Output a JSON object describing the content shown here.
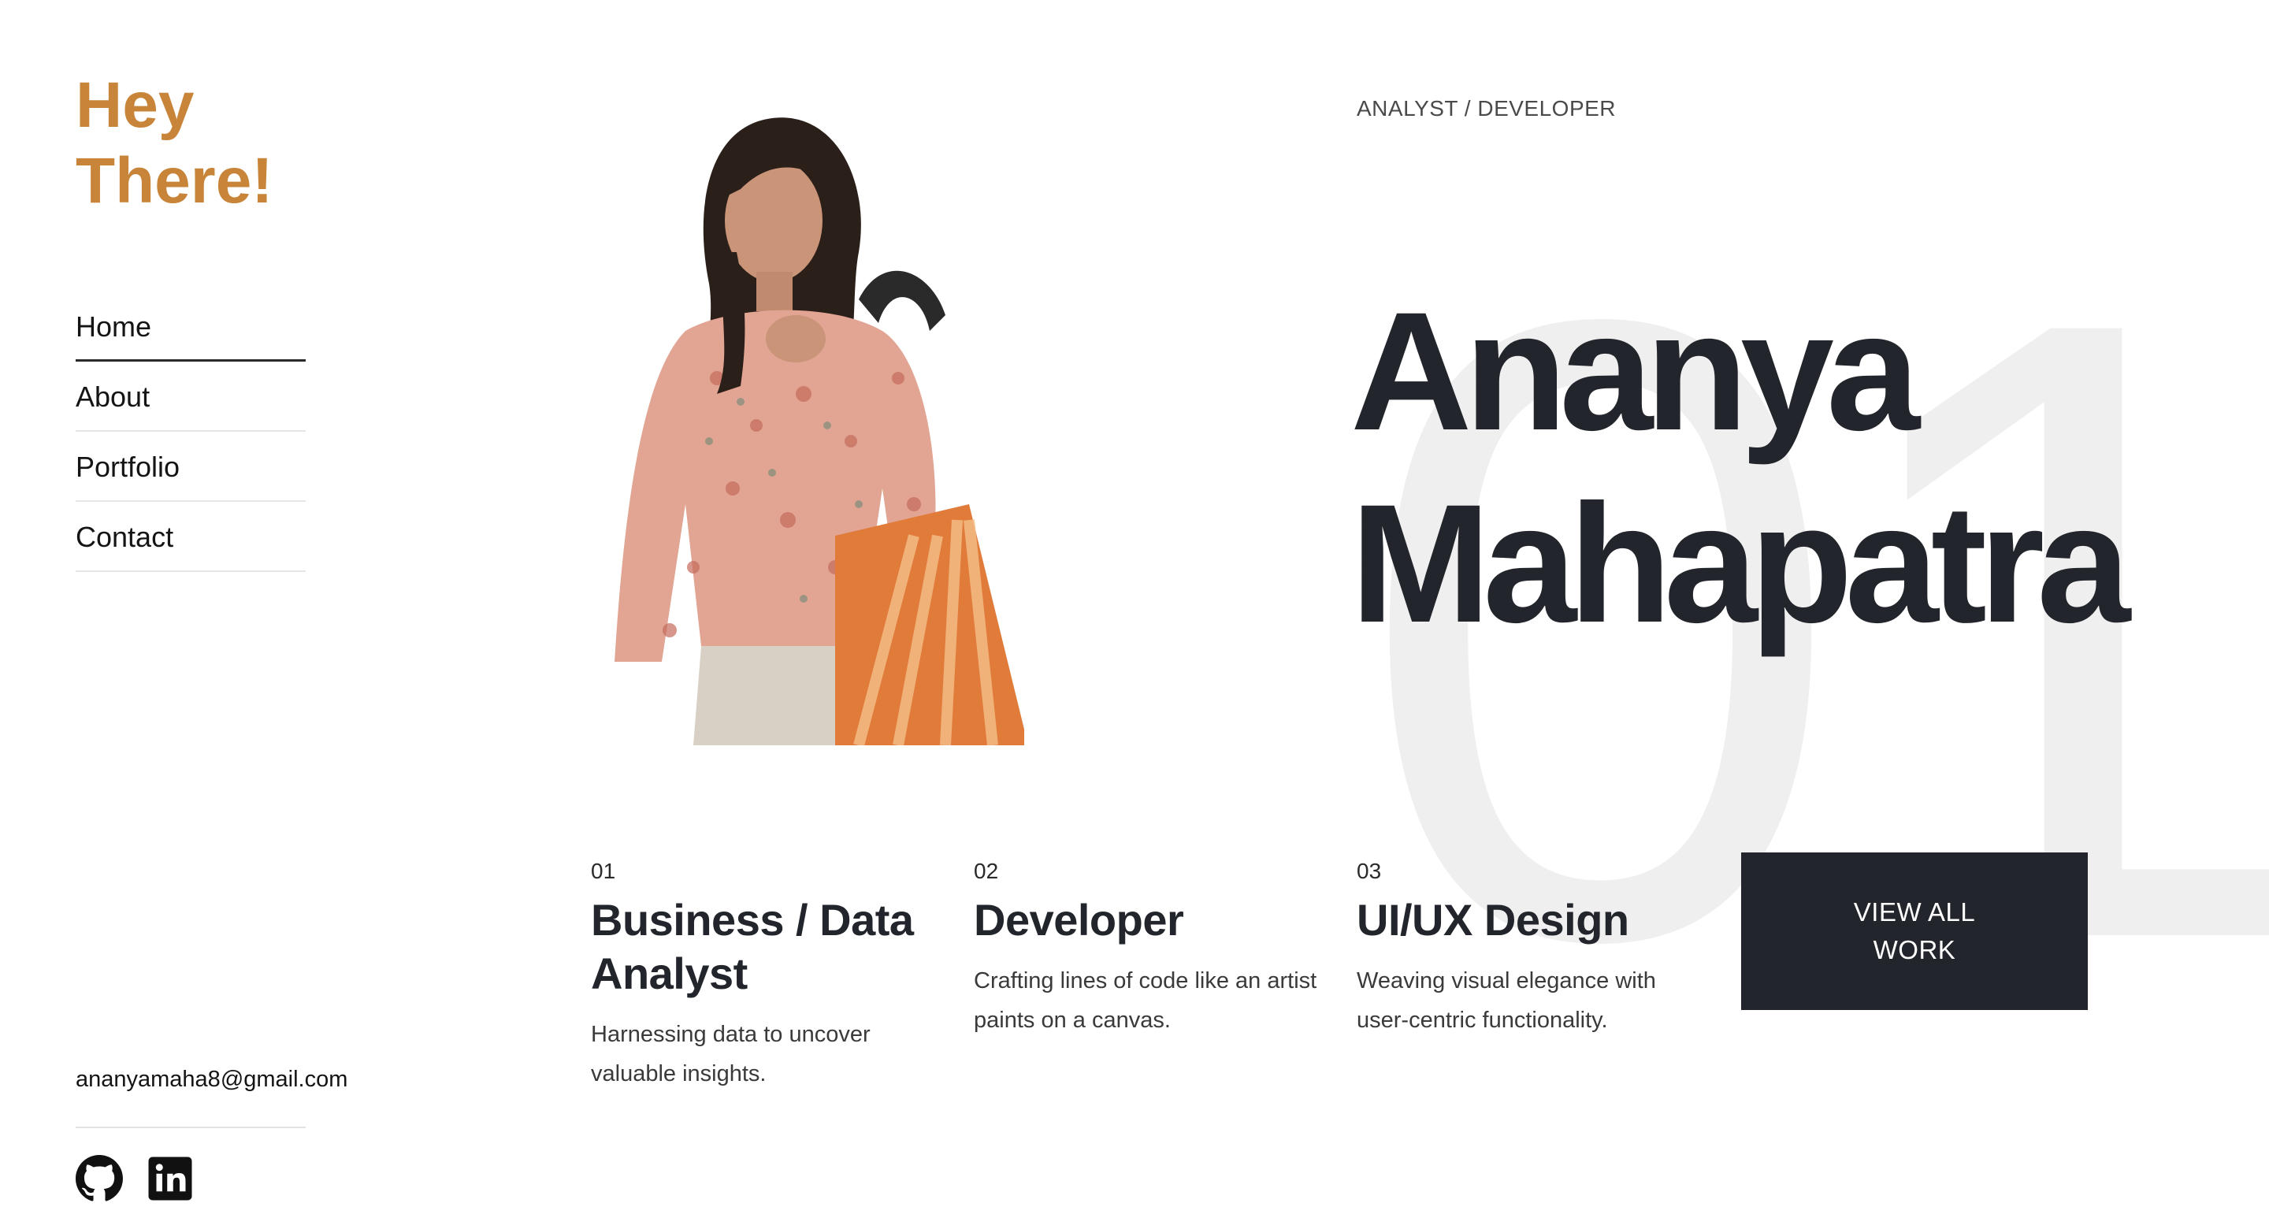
{
  "sidebar": {
    "greeting_line1": "Hey",
    "greeting_line2": "There!",
    "nav": [
      {
        "label": "Home",
        "active": true
      },
      {
        "label": "About",
        "active": false
      },
      {
        "label": "Portfolio",
        "active": false
      },
      {
        "label": "Contact",
        "active": false
      }
    ],
    "email": "ananyamaha8@gmail.com",
    "social": [
      "github-icon",
      "linkedin-icon"
    ]
  },
  "hero": {
    "role": "ANALYST / DEVELOPER",
    "first_name": "Ananya",
    "last_name": "Mahapatra",
    "watermark": "01"
  },
  "services": [
    {
      "num": "01",
      "title": "Business / Data Analyst",
      "desc": "Harnessing data to uncover valuable insights."
    },
    {
      "num": "02",
      "title": "Developer",
      "desc": "Crafting lines of code like an artist paints on a canvas."
    },
    {
      "num": "03",
      "title": "UI/UX Design",
      "desc": "Weaving visual elegance with user-centric functionality."
    }
  ],
  "cta": {
    "label": "VIEW ALL WORK"
  },
  "colors": {
    "accent": "#c8853a",
    "dark": "#22252b",
    "watermark": "#efefef"
  }
}
